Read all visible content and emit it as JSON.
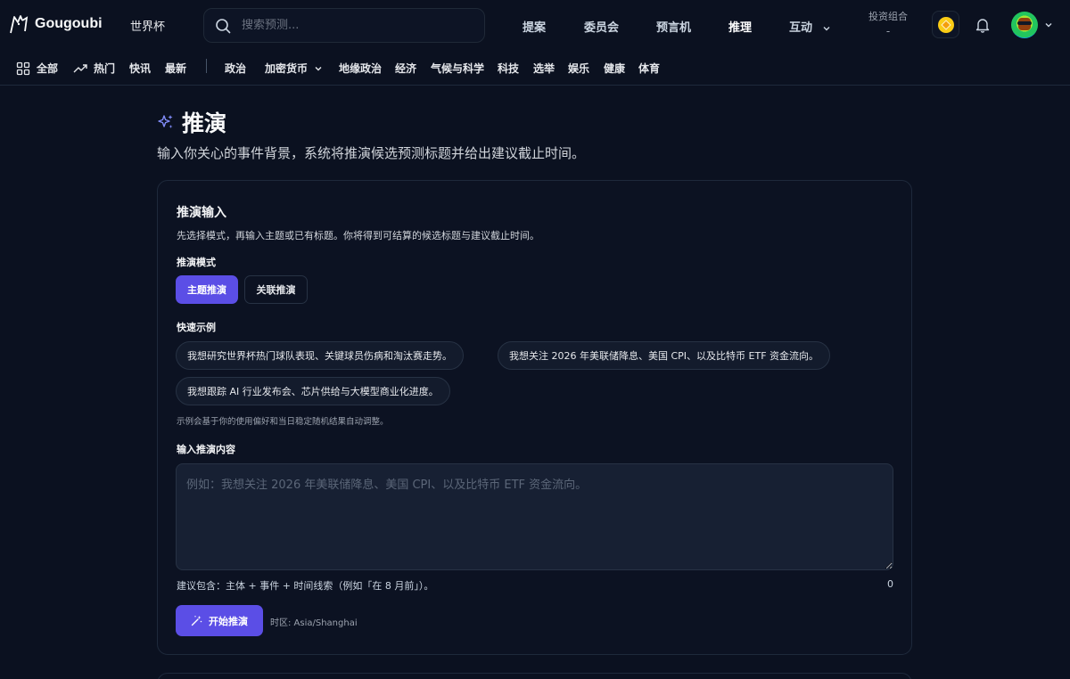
{
  "header": {
    "brand": "Gougoubi",
    "worldcup": "世界杯",
    "search_placeholder": "搜索预测...",
    "nav": [
      {
        "label": "提案"
      },
      {
        "label": "委员会"
      },
      {
        "label": "预言机"
      },
      {
        "label": "推理"
      },
      {
        "label": "互动"
      }
    ],
    "portfolio_label": "投资组合",
    "portfolio_value": "-"
  },
  "categories": {
    "all": "全部",
    "hot": "热门",
    "items": [
      "快讯",
      "最新",
      "政治",
      "加密货币",
      "地缘政治",
      "经济",
      "气候与科学",
      "科技",
      "选举",
      "娱乐",
      "健康",
      "体育"
    ]
  },
  "page": {
    "title": "推演",
    "subtitle": "输入你关心的事件背景，系统将推演候选预测标题并给出建议截止时间。"
  },
  "card": {
    "title": "推演输入",
    "description": "先选择模式，再输入主题或已有标题。你将得到可结算的候选标题与建议截止时间。",
    "mode_label": "推演模式",
    "mode_topic": "主题推演",
    "mode_related": "关联推演",
    "examples_label": "快速示例",
    "examples": [
      "我想研究世界杯热门球队表现、关键球员伤病和淘汰赛走势。",
      "我想关注 2026 年美联储降息、美国 CPI、以及比特币 ETF 资金流向。",
      "我想跟踪 AI 行业发布会、芯片供给与大模型商业化进度。"
    ],
    "examples_hint": "示例会基于你的使用偏好和当日稳定随机结果自动调整。",
    "input_label": "输入推演内容",
    "input_placeholder": "例如：我想关注 2026 年美联储降息、美国 CPI、以及比特币 ETF 资金流向。",
    "input_value": "",
    "suggestion": "建议包含：主体 + 事件 + 时间线索（例如「在 8 月前」）。",
    "char_count": "0",
    "start_button": "开始推演",
    "timezone": "时区: Asia/Shanghai"
  },
  "colors": {
    "background": "#0b1120",
    "accent": "#5b4ee6",
    "border": "#1e293b"
  }
}
